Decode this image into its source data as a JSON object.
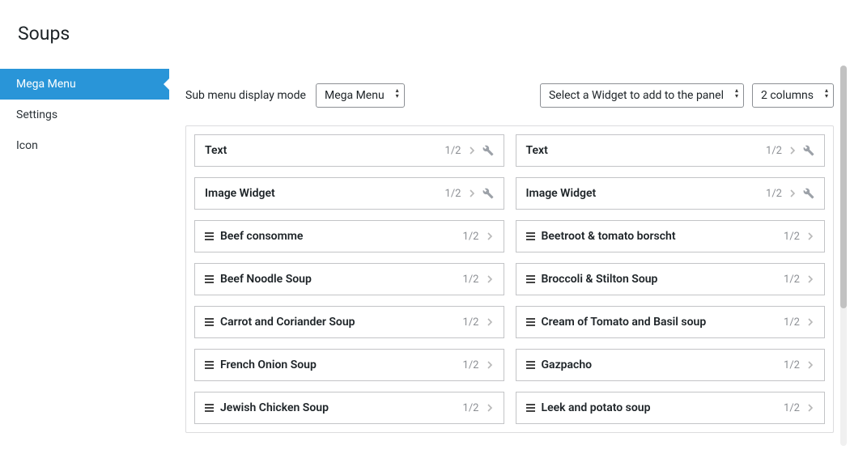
{
  "pageTitle": "Soups",
  "sidebar": {
    "items": [
      {
        "label": "Mega Menu",
        "active": true
      },
      {
        "label": "Settings",
        "active": false
      },
      {
        "label": "Icon",
        "active": false
      }
    ]
  },
  "toolbar": {
    "displayModeLabel": "Sub menu display mode",
    "displayModeValue": "Mega Menu",
    "widgetSelectValue": "Select a Widget to add to the panel",
    "columnsValue": "2 columns"
  },
  "panel": {
    "items": [
      {
        "title": "Text",
        "fraction": "1/2",
        "hasDragIcon": false,
        "hasWrench": true
      },
      {
        "title": "Text",
        "fraction": "1/2",
        "hasDragIcon": false,
        "hasWrench": true
      },
      {
        "title": "Image Widget",
        "fraction": "1/2",
        "hasDragIcon": false,
        "hasWrench": true
      },
      {
        "title": "Image Widget",
        "fraction": "1/2",
        "hasDragIcon": false,
        "hasWrench": true
      },
      {
        "title": "Beef consomme",
        "fraction": "1/2",
        "hasDragIcon": true,
        "hasWrench": false
      },
      {
        "title": "Beetroot & tomato borscht",
        "fraction": "1/2",
        "hasDragIcon": true,
        "hasWrench": false
      },
      {
        "title": "Beef Noodle Soup",
        "fraction": "1/2",
        "hasDragIcon": true,
        "hasWrench": false
      },
      {
        "title": "Broccoli & Stilton Soup",
        "fraction": "1/2",
        "hasDragIcon": true,
        "hasWrench": false
      },
      {
        "title": "Carrot and Coriander Soup",
        "fraction": "1/2",
        "hasDragIcon": true,
        "hasWrench": false
      },
      {
        "title": "Cream of Tomato and Basil soup",
        "fraction": "1/2",
        "hasDragIcon": true,
        "hasWrench": false
      },
      {
        "title": "French Onion Soup",
        "fraction": "1/2",
        "hasDragIcon": true,
        "hasWrench": false
      },
      {
        "title": "Gazpacho",
        "fraction": "1/2",
        "hasDragIcon": true,
        "hasWrench": false
      },
      {
        "title": "Jewish Chicken Soup",
        "fraction": "1/2",
        "hasDragIcon": true,
        "hasWrench": false
      },
      {
        "title": "Leek and potato soup",
        "fraction": "1/2",
        "hasDragIcon": true,
        "hasWrench": false
      }
    ]
  }
}
